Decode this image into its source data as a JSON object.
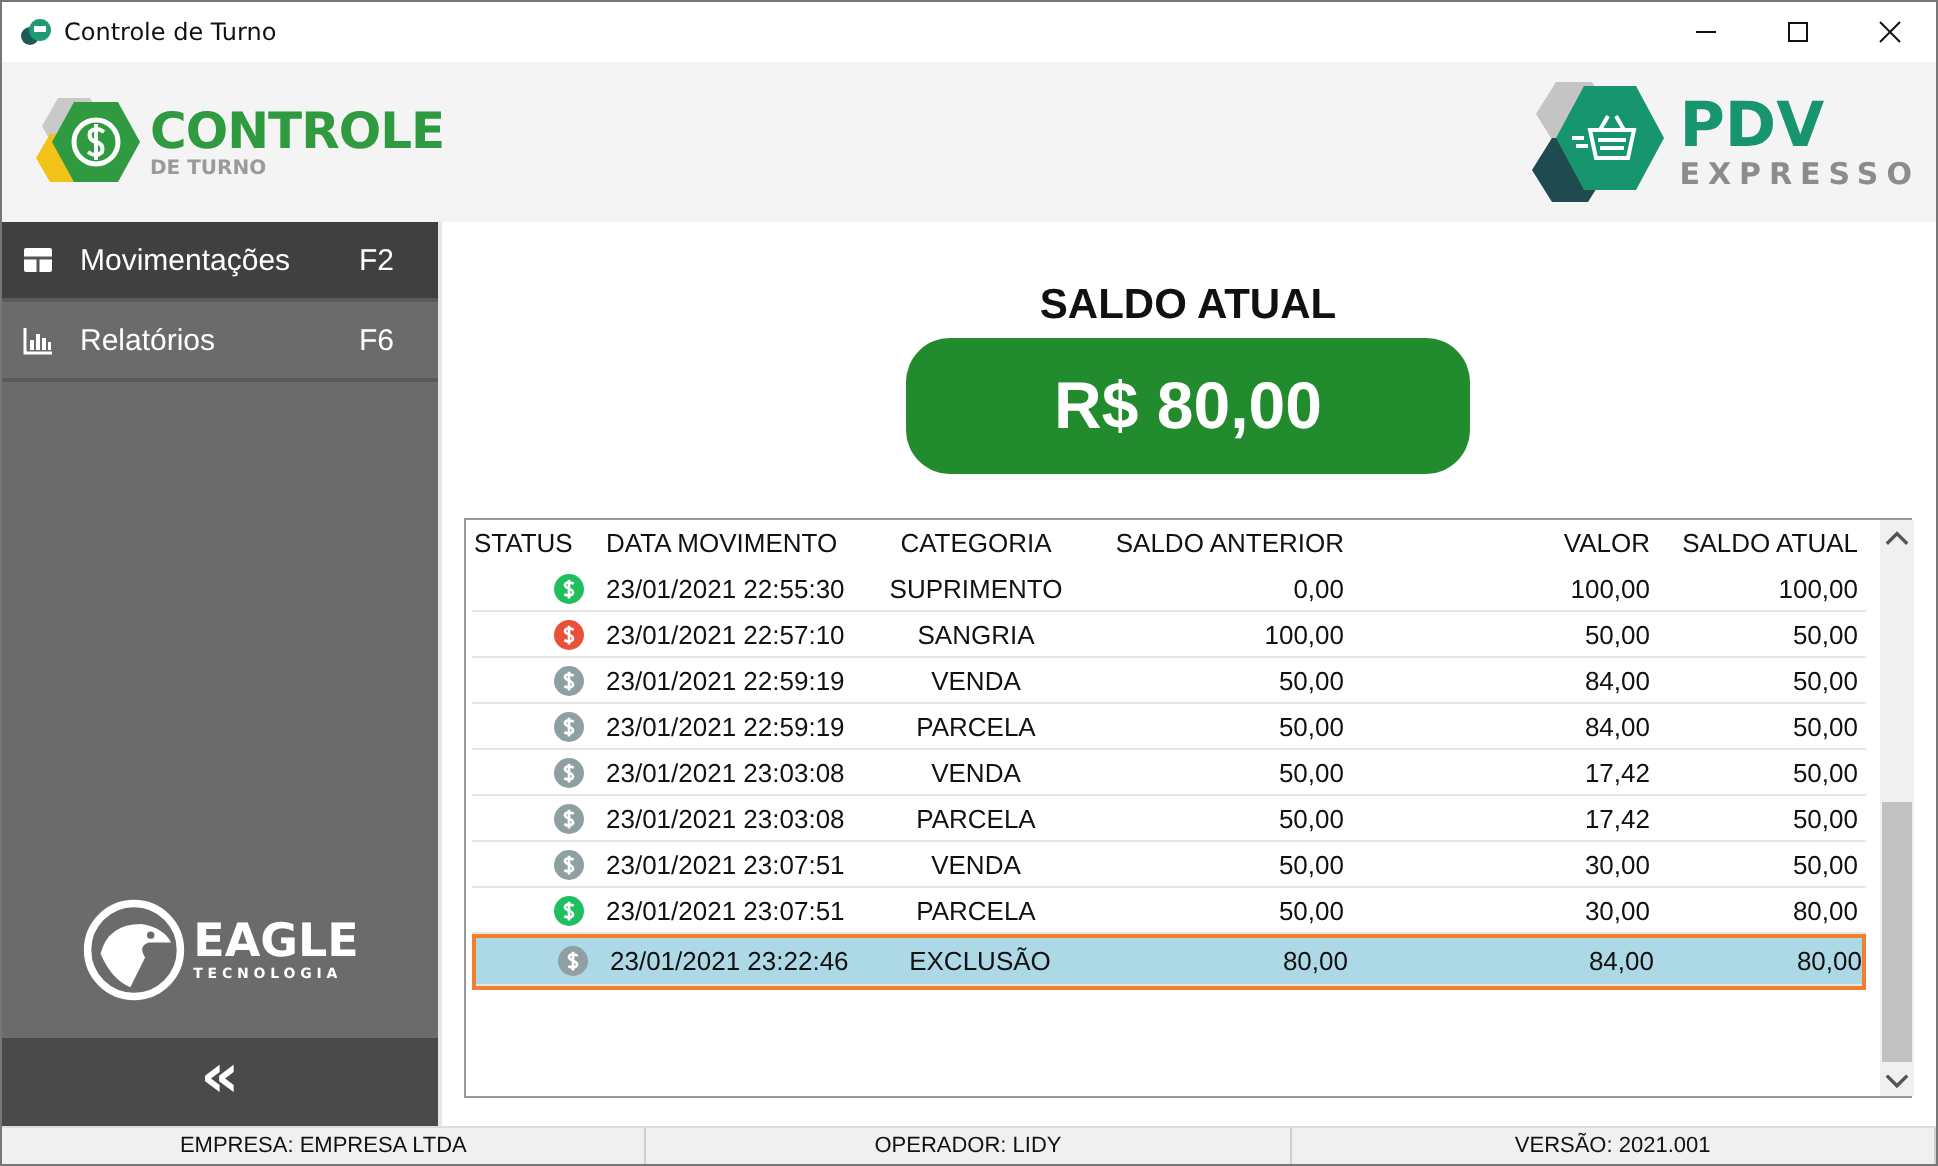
{
  "window": {
    "title": "Controle de Turno"
  },
  "brand": {
    "name": "CONTROLE",
    "subtitle": "DE TURNO"
  },
  "partner": {
    "name": "PDV",
    "subtitle": "EXPRESSO"
  },
  "sidebar": {
    "items": [
      {
        "label": "Movimentações",
        "shortcut": "F2",
        "kind": "table",
        "selected": true
      },
      {
        "label": "Relatórios",
        "shortcut": "F6",
        "kind": "chart",
        "selected": false
      }
    ],
    "footer_logo": {
      "name": "EAGLE",
      "subtitle": "TECNOLOGIA"
    },
    "collapse": "«"
  },
  "balance": {
    "label": "SALDO ATUAL",
    "value": "R$ 80,00"
  },
  "table": {
    "columns": [
      "STATUS",
      "DATA MOVIMENTO",
      "CATEGORIA",
      "SALDO ANTERIOR",
      "VALOR",
      "SALDO ATUAL"
    ],
    "rows": [
      {
        "color": "#1fbf5f",
        "date": "23/01/2021 22:55:30",
        "category": "SUPRIMENTO",
        "previous": "0,00",
        "amount": "100,00",
        "balance": "100,00",
        "selected": false
      },
      {
        "color": "#e8503a",
        "date": "23/01/2021 22:57:10",
        "category": "SANGRIA",
        "previous": "100,00",
        "amount": "50,00",
        "balance": "50,00",
        "selected": false
      },
      {
        "color": "#8fa0a3",
        "date": "23/01/2021 22:59:19",
        "category": "VENDA",
        "previous": "50,00",
        "amount": "84,00",
        "balance": "50,00",
        "selected": false
      },
      {
        "color": "#8fa0a3",
        "date": "23/01/2021 22:59:19",
        "category": "PARCELA",
        "previous": "50,00",
        "amount": "84,00",
        "balance": "50,00",
        "selected": false
      },
      {
        "color": "#8fa0a3",
        "date": "23/01/2021 23:03:08",
        "category": "VENDA",
        "previous": "50,00",
        "amount": "17,42",
        "balance": "50,00",
        "selected": false
      },
      {
        "color": "#8fa0a3",
        "date": "23/01/2021 23:03:08",
        "category": "PARCELA",
        "previous": "50,00",
        "amount": "17,42",
        "balance": "50,00",
        "selected": false
      },
      {
        "color": "#8fa0a3",
        "date": "23/01/2021 23:07:51",
        "category": "VENDA",
        "previous": "50,00",
        "amount": "30,00",
        "balance": "50,00",
        "selected": false
      },
      {
        "color": "#1fbf5f",
        "date": "23/01/2021 23:07:51",
        "category": "PARCELA",
        "previous": "50,00",
        "amount": "30,00",
        "balance": "80,00",
        "selected": false
      },
      {
        "color": "#8fa0a3",
        "date": "23/01/2021 23:22:46",
        "category": "EXCLUSÃO",
        "previous": "80,00",
        "amount": "84,00",
        "balance": "80,00",
        "selected": true
      }
    ]
  },
  "status_bar": [
    "EMPRESA: EMPRESA LTDA",
    "OPERADOR: LIDY",
    "VERSÃO: 2021.001"
  ]
}
